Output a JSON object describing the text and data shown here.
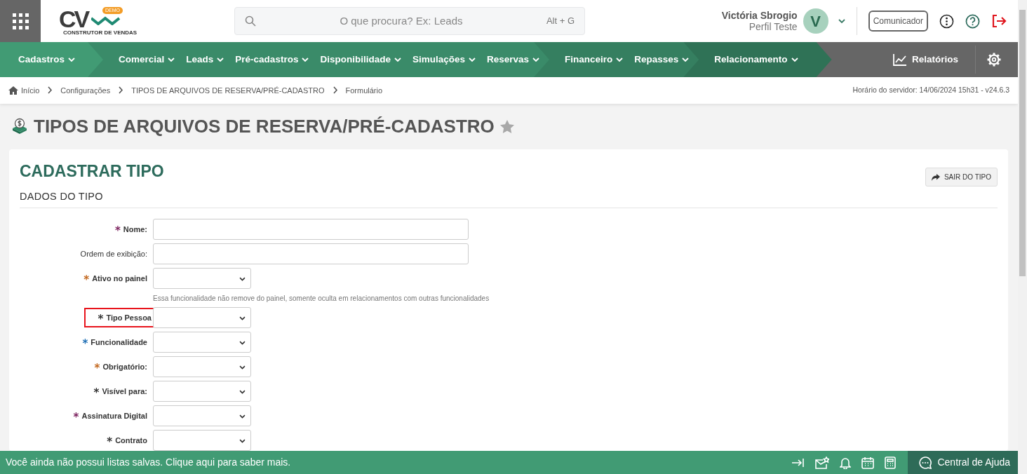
{
  "header": {
    "logo": {
      "text": "CV",
      "badge": "DEMO",
      "tagline": "CONSTRUTOR DE VENDAS"
    },
    "search": {
      "placeholder": "O que procura? Ex: Leads",
      "shortcut": "Alt + G"
    },
    "user": {
      "name": "Victória Sbrogio",
      "profile": "Perfil Teste",
      "initial": "V"
    },
    "communicator": "Comunicador"
  },
  "nav": {
    "groups": [
      {
        "color": "#419b74",
        "items": [
          "Cadastros"
        ]
      },
      {
        "color": "#3a8b69",
        "items": [
          "Comercial",
          "Leads",
          "Pré-cadastros",
          "Disponibilidade",
          "Simulações",
          "Reservas"
        ]
      },
      {
        "color": "#357f60",
        "items": [
          "Financeiro",
          "Repasses"
        ]
      },
      {
        "color": "#2f7256",
        "items": [
          "Relacionamento"
        ]
      }
    ],
    "reports": "Relatórios"
  },
  "breadcrumb": {
    "items": [
      "Início",
      "Configurações",
      "TIPOS DE ARQUIVOS DE RESERVA/PRÉ-CADASTRO",
      "Formulário"
    ],
    "server_time": "Horário do servidor: 14/06/2024 15h31 - v24.6.3"
  },
  "page_title": "TIPOS DE ARQUIVOS DE RESERVA/PRÉ-CADASTRO",
  "favorite": false,
  "card": {
    "title": "CADASTRAR TIPO",
    "exit_button": "SAIR DO TIPO",
    "section": "DADOS DO TIPO",
    "fields": [
      {
        "kind": "text",
        "asterisk": "*",
        "color": "#7a1f5c",
        "label": "Nome:",
        "highlighted": false
      },
      {
        "kind": "text",
        "label": "Ordem de exibição:",
        "highlighted": false
      },
      {
        "kind": "select",
        "asterisk": "*",
        "color": "#c2661c",
        "label": "Ativo no painel",
        "highlighted": false,
        "help": "Essa funcionalidade não remove do painel, somente oculta em relacionamentos com outras funcionalidades"
      },
      {
        "kind": "select",
        "asterisk": "*",
        "color": "#333333",
        "label": "Tipo Pessoa",
        "highlighted": true
      },
      {
        "kind": "select",
        "asterisk": "*",
        "color": "#1f6fb5",
        "label": "Funcionalidade",
        "highlighted": false
      },
      {
        "kind": "select",
        "asterisk": "*",
        "color": "#c2661c",
        "label": "Obrigatório:",
        "highlighted": false
      },
      {
        "kind": "select",
        "asterisk": "*",
        "color": "#333333",
        "label": "Visível para:",
        "highlighted": false
      },
      {
        "kind": "select",
        "asterisk": "*",
        "color": "#7a1f5c",
        "label": "Assinatura Digital",
        "highlighted": false
      },
      {
        "kind": "select",
        "asterisk": "*",
        "color": "#333333",
        "label": "Contrato",
        "highlighted": false
      }
    ]
  },
  "footer": {
    "message": "Você ainda não possui listas salvas. Clique aqui para saber mais.",
    "help_center": "Central de Ajuda"
  }
}
